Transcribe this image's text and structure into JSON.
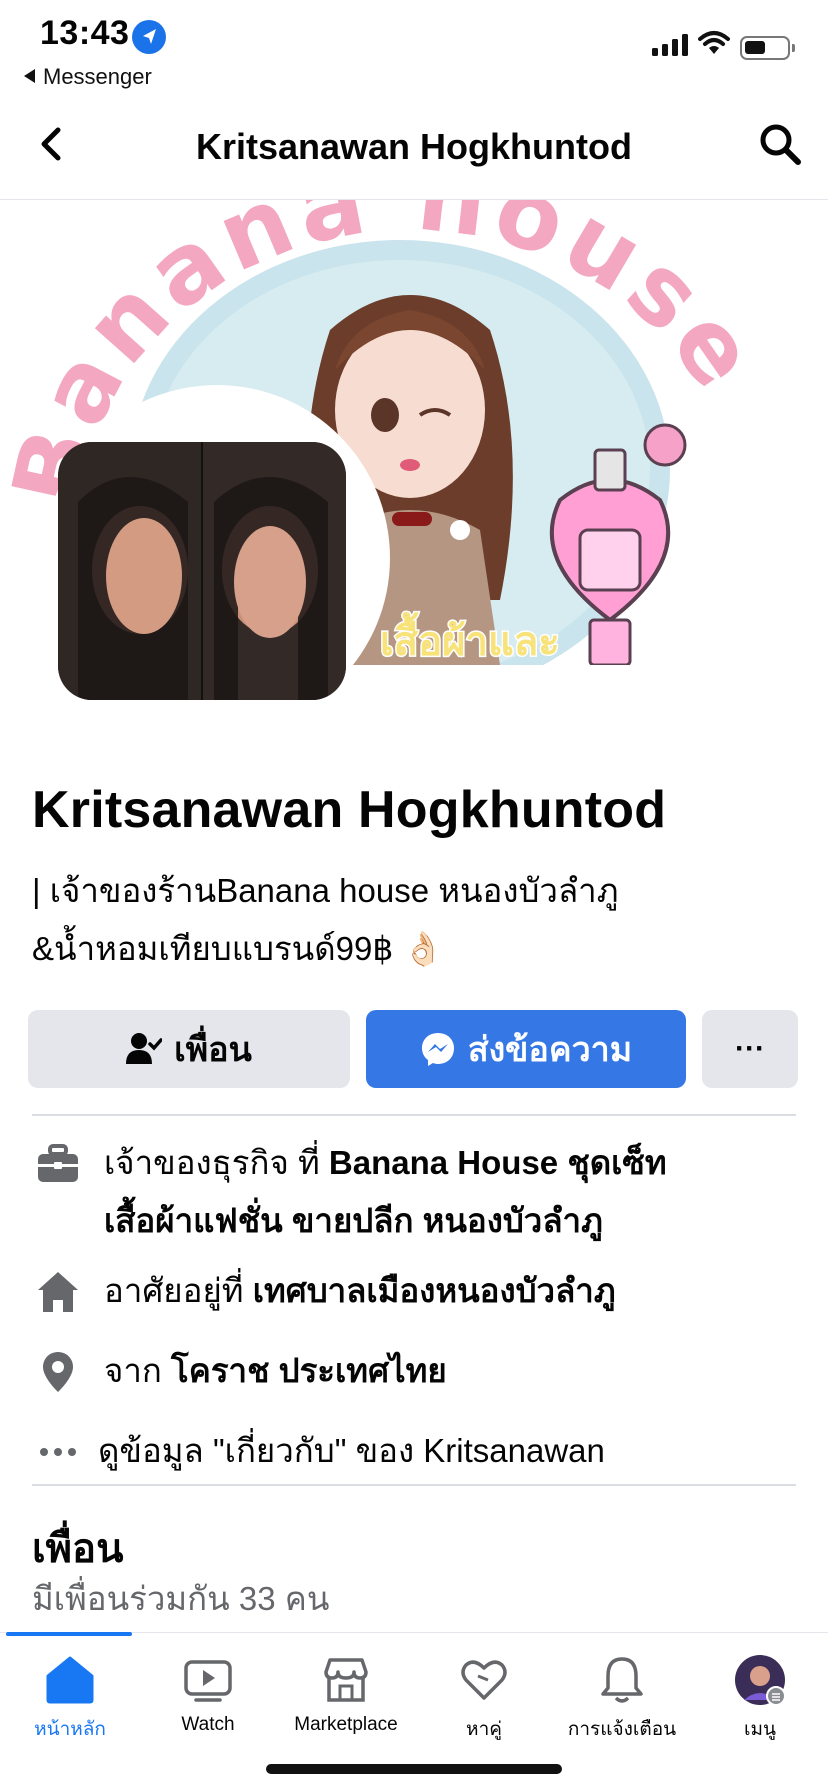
{
  "status_bar": {
    "time": "13:43",
    "back_app": "Messenger"
  },
  "header": {
    "title": "Kritsanawan Hogkhuntod"
  },
  "profile": {
    "name": "Kritsanawan Hogkhuntod",
    "bio_line1": " | เจ้าของร้านBanana house หนองบัวลำภู",
    "bio_line2": "&น้ำหอมเทียบแบรนด์99฿ 👌🏻"
  },
  "cover": {
    "title_text": "Banana house",
    "subtitle_text": "เสื้อผ้าและ"
  },
  "actions": {
    "friend_label": "เพื่อน",
    "message_label": "ส่งข้อความ",
    "more_label": "···"
  },
  "details": {
    "work_prefix": "เจ้าของธุรกิจ ที่ ",
    "work_place_line1": "Banana House ชุดเซ็ท",
    "work_place_line2": "เสื้อผ้าแฟชั่น ขายปลีก หนองบัวลำภู",
    "lives_prefix": "อาศัยอยู่ที่ ",
    "lives_place": "เทศบาลเมืองหนองบัวลำภู",
    "from_prefix": "จาก ",
    "from_place": "โคราช ประเทศไทย",
    "about_link": "ดูข้อมูล \"เกี่ยวกับ\" ของ Kritsanawan"
  },
  "friends": {
    "heading": "เพื่อน",
    "mutual": "มีเพื่อนร่วมกัน 33 คน"
  },
  "tabs": [
    {
      "label": "หน้าหลัก",
      "icon": "home-icon",
      "active": true
    },
    {
      "label": "Watch",
      "icon": "watch-icon"
    },
    {
      "label": "Marketplace",
      "icon": "marketplace-icon"
    },
    {
      "label": "หาคู่",
      "icon": "dating-icon"
    },
    {
      "label": "การแจ้งเตือน",
      "icon": "bell-icon"
    },
    {
      "label": "เมนู",
      "icon": "menu-avatar-icon"
    }
  ],
  "colors": {
    "accent": "#1877f2",
    "message_button": "#3578e5",
    "secondary_button": "#e4e6eb"
  }
}
